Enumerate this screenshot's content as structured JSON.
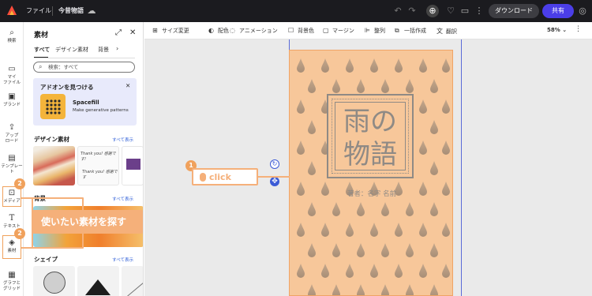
{
  "topbar": {
    "file_menu": "ファイル",
    "doc_title": "今昔物語",
    "download_label": "ダウンロード",
    "share_label": "共有"
  },
  "rail": {
    "items": [
      {
        "label": "検索",
        "icon": "search-icon"
      },
      {
        "label": "マイ\nファイル",
        "icon": "folder-icon"
      },
      {
        "label": "ブランド",
        "icon": "brand-icon"
      },
      {
        "label": "アップ\nロード",
        "icon": "upload-icon"
      },
      {
        "label": "テンプレート",
        "icon": "template-icon"
      },
      {
        "label": "メディア",
        "icon": "media-icon"
      },
      {
        "label": "テキスト",
        "icon": "text-icon"
      },
      {
        "label": "素材",
        "icon": "shapes-icon"
      },
      {
        "label": "グラフと\nグリッド",
        "icon": "grid-icon"
      }
    ]
  },
  "panel": {
    "title": "素材",
    "tabs": [
      "すべて",
      "デザイン素材",
      "背景"
    ],
    "search_placeholder": "検索：すべて",
    "addon": {
      "heading": "アドオンを見つける",
      "name": "Spacefill",
      "desc": "Make generative patterns"
    },
    "sections": [
      {
        "title": "デザイン素材",
        "more": "すべて表示"
      },
      {
        "title": "背景",
        "more": "すべて表示"
      },
      {
        "title": "シェイプ",
        "more": "すべて表示"
      }
    ],
    "thumb_caption_1": "Thank you! 感謝です!",
    "thumb_caption_2": "Thank you! 感謝です"
  },
  "toolbar": {
    "items": [
      "サイズ変更",
      "配色",
      "アニメーション",
      "背景色",
      "マージン",
      "整列",
      "一括作成",
      "翻訳"
    ],
    "zoom": "58%"
  },
  "document": {
    "title_line1": "雨の",
    "title_line2": "物語",
    "author": "著者：名字 名前"
  },
  "annotations": {
    "click_label": "click",
    "callout_text": "使いたい素材を探す",
    "step1": "1",
    "step2a": "2",
    "step2b": "2"
  },
  "colors": {
    "accent": "#4b3ee8",
    "callout": "#f5b07a",
    "page_bg": "#f7c79a",
    "title_gray": "#8f8a85"
  }
}
